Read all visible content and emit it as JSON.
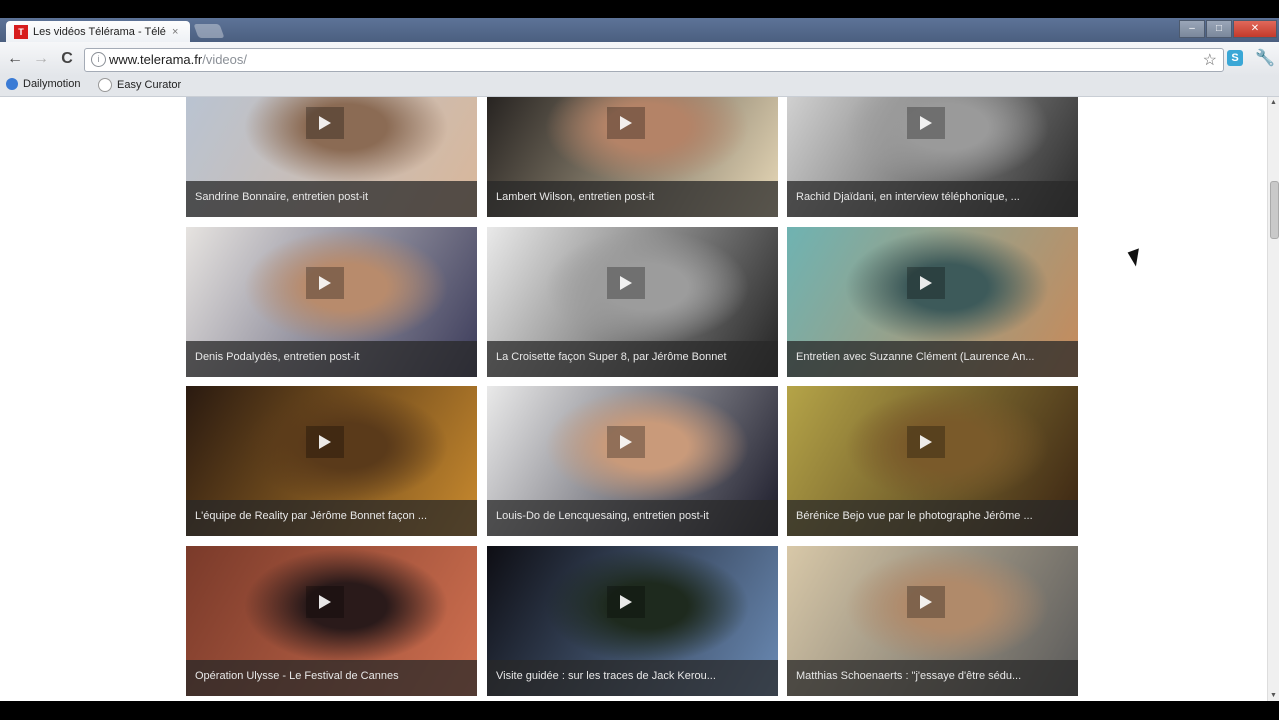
{
  "tab": {
    "title": "Les vidéos Télérama - Télé",
    "favicon_letter": "T",
    "close": "×"
  },
  "window_controls": [
    "–",
    "□",
    "✕"
  ],
  "toolbar": {
    "back": "←",
    "forward": "→",
    "reload": "C",
    "url_host": "www.telerama.fr",
    "url_path": "/videos/",
    "star": "☆",
    "ext": "S",
    "wrench": "🔧"
  },
  "bookmarks": [
    {
      "label": "Dailymotion",
      "color": "#3a7bd5"
    },
    {
      "label": "Easy Curator",
      "color": "#ffffff"
    }
  ],
  "videos": [
    {
      "caption": "Sandrine Bonnaire, entretien post-it",
      "colors": [
        "#b8c4d4",
        "#d9b79a",
        "#8b6b54"
      ]
    },
    {
      "caption": "Lambert Wilson, entretien post-it",
      "colors": [
        "#1e1b1a",
        "#e8d9b8",
        "#b48367"
      ]
    },
    {
      "caption": "Rachid Djaïdani, en interview téléphonique, ...",
      "colors": [
        "#d8d8d8",
        "#2a2a2a",
        "#9a9a9a"
      ]
    },
    {
      "caption": "Denis Podalydès, entretien post-it",
      "colors": [
        "#e6e3e0",
        "#3b3b5a",
        "#b88b6c"
      ]
    },
    {
      "caption": "La Croisette façon Super 8, par Jérôme Bonnet",
      "colors": [
        "#e9e9e9",
        "#222",
        "#9c9c9c"
      ]
    },
    {
      "caption": "Entretien avec Suzanne Clément (Laurence An...",
      "colors": [
        "#6fb3b2",
        "#c78a5a",
        "#3d5a5a"
      ]
    },
    {
      "caption": "L'équipe de Reality par Jérôme Bonnet façon ...",
      "colors": [
        "#2a1a10",
        "#c98a2e",
        "#5a3a1a"
      ]
    },
    {
      "caption": "Louis-Do de Lencquesaing, entretien post-it",
      "colors": [
        "#e9e9e9",
        "#1b1b2a",
        "#c99a7a"
      ]
    },
    {
      "caption": "Bérénice Bejo vue par le photographe Jérôme ...",
      "colors": [
        "#b5a448",
        "#3a2412",
        "#7a5a2a"
      ]
    },
    {
      "caption": "Opération Ulysse - Le Festival de Cannes",
      "colors": [
        "#7a3a2a",
        "#d07050",
        "#2a1a1a"
      ]
    },
    {
      "caption": "Visite guidée : sur les traces de Jack Kerou...",
      "colors": [
        "#0e0e14",
        "#6a8ab4",
        "#1e2a1e"
      ]
    },
    {
      "caption": "Matthias Schoenaerts : \"j'essaye d'être sédu...",
      "colors": [
        "#d8c8a8",
        "#5a5a5a",
        "#b08a6a"
      ]
    }
  ]
}
